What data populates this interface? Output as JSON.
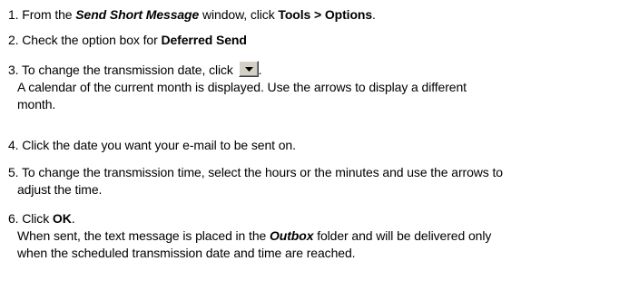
{
  "steps": [
    {
      "num": "1.",
      "pre": "From the ",
      "window_name": "Send Short Message",
      "mid": " window, click ",
      "menu_path": "Tools > Options",
      "post": "."
    },
    {
      "num": "2.",
      "pre": "Check the option box for ",
      "option_name": "Deferred Send"
    },
    {
      "num": "3.",
      "pre": "To change the transmission date, click ",
      "post": ".",
      "sub_line1": "A calendar of the current month is displayed. Use the arrows to display a different",
      "sub_line2": "month.",
      "icon": "dropdown-arrow-icon"
    },
    {
      "num": "4.",
      "text": "Click the date you want your e-mail to be sent on."
    },
    {
      "num": "5.",
      "line1": "To change the transmission time, select the hours or the minutes and use the arrows to",
      "line2": "adjust the time."
    },
    {
      "num": "6.",
      "pre": "Click ",
      "button_name": "OK",
      "post": ".",
      "sub_pre": "When sent, the text message is placed in the ",
      "folder_name": "Outbox",
      "sub_mid": " folder and will be delivered only",
      "sub_line2": "when the scheduled transmission date and time are reached."
    }
  ]
}
